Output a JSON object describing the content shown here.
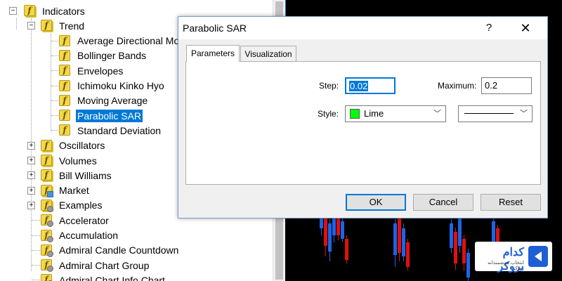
{
  "navigator": {
    "root_label": "Indicators",
    "trend_label": "Trend",
    "trend_items": [
      {
        "label": "Average Directional Mo",
        "selected": false
      },
      {
        "label": "Bollinger Bands",
        "selected": false
      },
      {
        "label": "Envelopes",
        "selected": false
      },
      {
        "label": "Ichimoku Kinko Hyo",
        "selected": false
      },
      {
        "label": "Moving Average",
        "selected": false
      },
      {
        "label": "Parabolic SAR",
        "selected": true
      },
      {
        "label": "Standard Deviation",
        "selected": false
      }
    ],
    "groups": [
      {
        "label": "Oscillators",
        "expander": "+"
      },
      {
        "label": "Volumes",
        "expander": "+"
      },
      {
        "label": "Bill Williams",
        "expander": "+"
      },
      {
        "label": "Market",
        "expander": "+"
      },
      {
        "label": "Examples",
        "expander": "+"
      }
    ],
    "custom_items": [
      {
        "label": "Accelerator"
      },
      {
        "label": "Accumulation"
      },
      {
        "label": "Admiral Candle Countdown"
      },
      {
        "label": "Admiral Chart Group"
      },
      {
        "label": "Admiral Chart Info Chart"
      }
    ],
    "expander_minus": "−",
    "icon_glyph": "f"
  },
  "dialog": {
    "title": "Parabolic SAR",
    "help_glyph": "?",
    "close_glyph": "✕",
    "tabs": {
      "parameters": "Parameters",
      "visualization": "Visualization"
    },
    "step_label": "Step:",
    "step_value": "0.02",
    "maximum_label": "Maximum:",
    "maximum_value": "0.2",
    "style_label": "Style:",
    "style_color_name": "Lime",
    "style_color": "#00ff00",
    "dropdown_glyph": "﹀",
    "buttons": {
      "ok": "OK",
      "cancel": "Cancel",
      "reset": "Reset"
    }
  },
  "watermark": {
    "name": "کدام بروکر",
    "tagline": "انتخاب هوشمندانه بروکر"
  },
  "colors": {
    "accent": "#0078d7",
    "bull_candle": "#1e64e6",
    "bear_candle": "#e01010",
    "chart_bg": "#000000"
  }
}
